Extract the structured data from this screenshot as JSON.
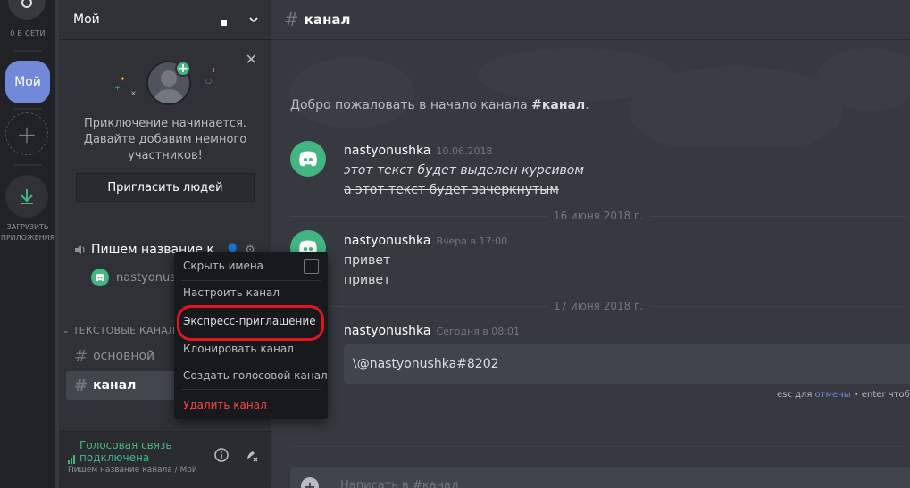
{
  "rail": {
    "online_label": "0 В СЕТИ",
    "server_label": "Мой",
    "download_label_1": "ЗАГРУЗИТЬ",
    "download_label_2": "ПРИЛОЖЕНИЯ"
  },
  "guild": {
    "name": "Мой"
  },
  "invite_card": {
    "line1": "Приключение начинается.",
    "line2": "Давайте добавим немного",
    "line3": "участников!",
    "button": "Пригласить людей"
  },
  "voice_channel": {
    "name": "Пишем название к",
    "user": "nastyonushka"
  },
  "category": {
    "name": "ТЕКСТОВЫЕ КАНАЛ"
  },
  "text_channels": [
    {
      "name": "основной",
      "active": false
    },
    {
      "name": "канал",
      "active": true
    }
  ],
  "voice_status": {
    "title_1": "Голосовая связь",
    "title_2": "подключена",
    "subtitle": "Пишем название канала / Мой"
  },
  "channel_header": {
    "name": "канал"
  },
  "welcome": {
    "prefix": "Добро пожаловать в начало канала ",
    "channel": "#канал",
    "suffix": "."
  },
  "messages": [
    {
      "author": "nastyonushka",
      "time": "10.06.2018",
      "lines": [
        "этот текст будет выделен курсивом",
        "а этот текст будет зачеркнутым"
      ]
    },
    {
      "author": "nastyonushka",
      "time": "Вчера в 17:00",
      "lines": [
        "привет",
        "привет"
      ]
    },
    {
      "author": "nastyonushka",
      "time": "Сегодня в 08:01",
      "lines": []
    }
  ],
  "dividers": [
    "16 июня 2018 г.",
    "17 июня 2018 г."
  ],
  "edit": {
    "value": "\\@nastyonushka#8202",
    "hint_prefix": "esc для ",
    "hint_link": "отмены",
    "hint_suffix": " • enter чтобы"
  },
  "composer": {
    "placeholder": "Написать в #канал"
  },
  "context_menu": {
    "items": [
      "Скрыть имена",
      "Настроить канал",
      "Экспресс-приглашение",
      "Клонировать канал",
      "Создать голосовой канал",
      "Удалить канал"
    ]
  },
  "colors": {
    "accent": "#7289da",
    "green": "#43b581",
    "danger": "#f04747",
    "highlight": "#e0171d"
  }
}
